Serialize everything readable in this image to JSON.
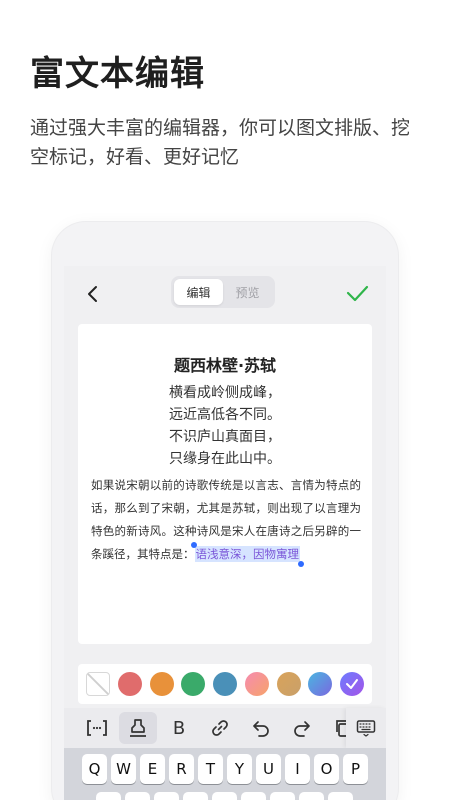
{
  "hero": {
    "title": "富文本编辑",
    "subtitle": "通过强大丰富的编辑器，你可以图文排版、挖空标记，好看、更好记忆"
  },
  "editor": {
    "tabs": [
      {
        "label": "编辑",
        "active": true
      },
      {
        "label": "预览",
        "active": false
      }
    ],
    "back_icon": "chevron-left-icon",
    "done_icon": "check-icon",
    "accent": "#2fb54a"
  },
  "document": {
    "title": "题西林壁·苏轼",
    "poem": [
      "横看成岭侧成峰，",
      "远近高低各不同。",
      "不识庐山真面目，",
      "只缘身在此山中。"
    ],
    "paragraph": "如果说宋朝以前的诗歌传统是以言志、言情为特点的话，那么到了宋朝，尤其是苏轼，则出现了以言理为特色的新诗风。这种诗风是宋人在唐诗之后另辟的一条蹊径，其特点是：",
    "highlight": "语浅意深，因物寓理"
  },
  "colors": [
    {
      "name": "none",
      "value": "transparent"
    },
    {
      "name": "red",
      "value": "#e06c6c"
    },
    {
      "name": "orange",
      "value": "#e8913a"
    },
    {
      "name": "green",
      "value": "#3aaa6a"
    },
    {
      "name": "blue",
      "value": "#4a90b8"
    },
    {
      "name": "pink-gradient",
      "value": "#f58bb0"
    },
    {
      "name": "gold-gradient",
      "value": "#d9a35a"
    },
    {
      "name": "blue-gradient",
      "value": "#5aa0e8"
    },
    {
      "name": "purple-gradient",
      "value": "#8a62e0"
    }
  ],
  "toolbar": {
    "bold_label": "B",
    "tools": [
      "cloze-icon",
      "highlighter-icon",
      "bold-icon",
      "link-icon",
      "undo-icon",
      "redo-icon",
      "copy-icon"
    ],
    "keyboard_icon": "keyboard-icon"
  },
  "keyboard": {
    "row1": [
      "Q",
      "W",
      "E",
      "R",
      "T",
      "Y",
      "U",
      "I",
      "O",
      "P"
    ],
    "row2": [
      "A",
      "S",
      "D",
      "F",
      "G",
      "H",
      "J",
      "K",
      "L"
    ]
  }
}
